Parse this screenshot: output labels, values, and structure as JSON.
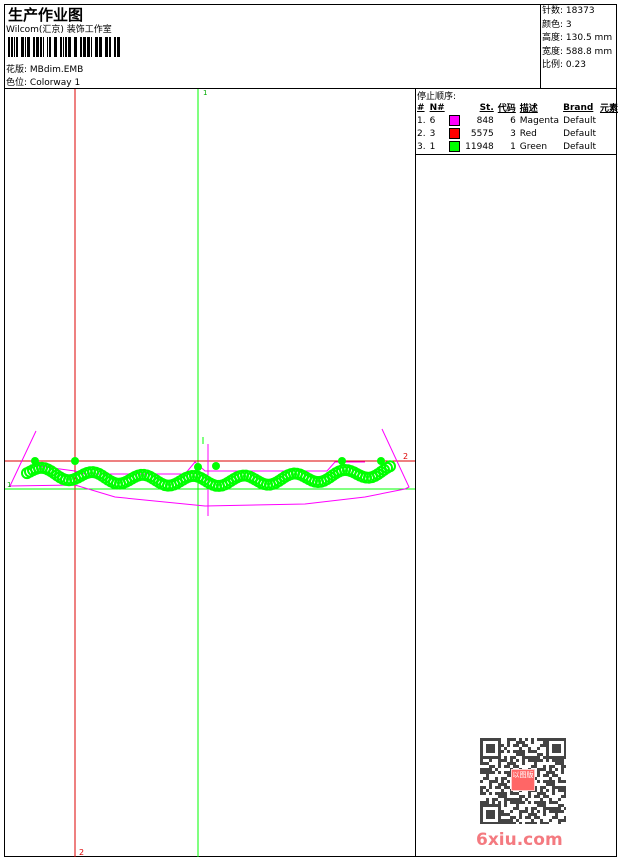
{
  "header": {
    "title": "生产作业图",
    "company": "Wilcom(汇京) 装饰工作室",
    "design_label": "花版:",
    "design_value": "MBdim.EMB",
    "colorway_label": "色位:",
    "colorway_value": "Colorway 1"
  },
  "info": {
    "stitches_label": "针数:",
    "stitches": "18373",
    "colors_label": "颜色:",
    "colors": "3",
    "height_label": "高度:",
    "height": "130.5 mm",
    "width_label": "宽度:",
    "width": "588.8 mm",
    "scale_label": "比例:",
    "scale": "0.23"
  },
  "sequence": {
    "title": "停止顺序:",
    "columns": [
      "#",
      "N#",
      "",
      "St.",
      "代码",
      "描述",
      "Brand",
      "元素"
    ],
    "rows": [
      {
        "num": "1.",
        "n": "6",
        "color": "#ff00ff",
        "st": "848",
        "code": "6",
        "desc": "Magenta",
        "brand": "Default"
      },
      {
        "num": "2.",
        "n": "3",
        "color": "#ff0000",
        "st": "5575",
        "code": "3",
        "desc": "Red",
        "brand": "Default"
      },
      {
        "num": "3.",
        "n": "1",
        "color": "#00ff00",
        "st": "11948",
        "code": "1",
        "desc": "Green",
        "brand": "Default"
      }
    ]
  },
  "canvas": {
    "axis_top": "1",
    "axis_bottom": "2",
    "axis_right": "2",
    "axis_left": "1"
  },
  "watermark": {
    "text": "6xiu.com",
    "stamp": "以图版"
  }
}
